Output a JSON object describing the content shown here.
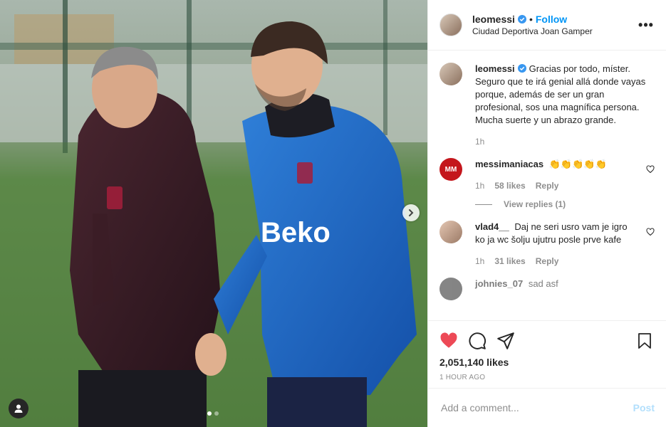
{
  "post": {
    "username": "leomessi",
    "follow_label": "Follow",
    "separator": "•",
    "location": "Ciudad Deportiva Joan Gamper",
    "more_label": "•••",
    "caption": "Gracias por todo, míster. Seguro que te irá genial allá donde vayas porque, además de ser un gran profesional, sos una magnífica persona. Mucha suerte y un abrazo grande.",
    "caption_time": "1h",
    "likes": "2,051,140 likes",
    "time_ago": "1 HOUR AGO",
    "photo_jersey_text": "Beko"
  },
  "comments": [
    {
      "username": "messimaniacas",
      "text": "👏👏👏👏👏",
      "avatar_text": "MM",
      "avatar_color": "#c4161c",
      "time": "1h",
      "likes": "58 likes",
      "reply_label": "Reply",
      "view_replies": "View replies (1)"
    },
    {
      "username": "vlad4__",
      "text": "Daj ne seri usro vam je igro ko ja wc šolju ujutru posle prve kafe",
      "time": "1h",
      "likes": "31 likes",
      "reply_label": "Reply"
    },
    {
      "username": "johnies_07",
      "text": "sad asf"
    }
  ],
  "add_comment": {
    "placeholder": "Add a comment...",
    "post_label": "Post"
  },
  "colors": {
    "accent": "#0095f6",
    "like_red": "#ed4956",
    "muted": "#8e8e8e"
  },
  "carousel": {
    "current": 1,
    "total": 2
  }
}
